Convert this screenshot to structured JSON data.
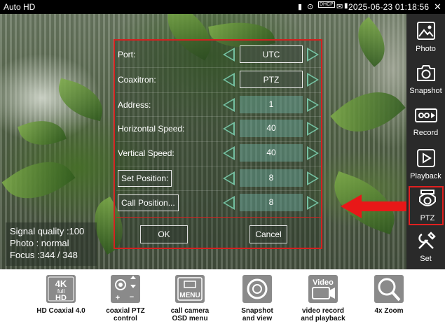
{
  "statusbar": {
    "title": "Auto HD",
    "icons_text": "▮ ⊙",
    "dhcp_label": "DHCP",
    "clock": "2025-06-23 01:18:56",
    "close_glyph": "✕"
  },
  "sidebar": {
    "items": [
      {
        "label": "Photo",
        "icon": "photo-icon"
      },
      {
        "label": "Snapshot",
        "icon": "camera-icon"
      },
      {
        "label": "Record",
        "icon": "video-record-icon"
      },
      {
        "label": "Playback",
        "icon": "play-icon"
      },
      {
        "label": "PTZ",
        "icon": "ptz-camera-icon"
      },
      {
        "label": "Set",
        "icon": "tools-icon"
      }
    ],
    "highlight_color": "#e02020"
  },
  "panel": {
    "rows": [
      {
        "label": "Port:",
        "value": "UTC"
      },
      {
        "label": "Coaxitron:",
        "value": "PTZ"
      },
      {
        "label": "Address:",
        "value": "1"
      },
      {
        "label": "Horizontal Speed:",
        "value": "40"
      },
      {
        "label": "Vertical Speed:",
        "value": "40"
      },
      {
        "label": "Set Position:",
        "value": "8"
      },
      {
        "label": "Call Position...",
        "value": "8"
      }
    ],
    "ok_label": "OK",
    "cancel_label": "Cancel",
    "border_color": "#d42020"
  },
  "overlay": {
    "signal": "Signal quality :100",
    "photo": "Photo : normal",
    "focus": "Focus :344 / 348"
  },
  "features": [
    {
      "line1": "HD Coaxial 4.0",
      "line2": "",
      "icon": "4k-full-hd-icon"
    },
    {
      "line1": "coaxial PTZ",
      "line2": "control",
      "icon": "ptz-control-icon"
    },
    {
      "line1": "call camera",
      "line2": "OSD menu",
      "icon": "menu-icon"
    },
    {
      "line1": "Snapshot",
      "line2": "and view",
      "icon": "snapshot-icon"
    },
    {
      "line1": "video record",
      "line2": "and playback",
      "icon": "video-icon"
    },
    {
      "line1": "4x Zoom",
      "line2": "",
      "icon": "zoom-icon"
    }
  ],
  "feature_icon_texts": {
    "k4": "4K",
    "full": "full",
    "hd": "HD",
    "menu": "MENU",
    "video": "Video"
  }
}
